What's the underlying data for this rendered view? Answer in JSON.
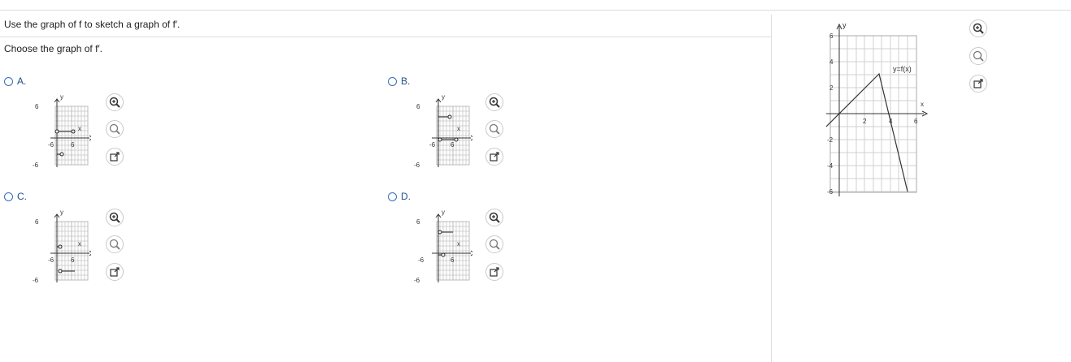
{
  "question": {
    "text": "Use the graph of f to sketch a graph of f′."
  },
  "prompt": {
    "text": "Choose the graph of f′."
  },
  "options": [
    {
      "letter": "A.",
      "y_top_label": "6",
      "y_bottom_label": "-6",
      "x_label": "x",
      "y_label": "y",
      "x_tick_left": "-6",
      "x_tick_right": "6"
    },
    {
      "letter": "B.",
      "y_top_label": "6",
      "y_bottom_label": "-6",
      "x_label": "x",
      "y_label": "y",
      "x_tick_left": "-6",
      "x_tick_right": "6"
    },
    {
      "letter": "C.",
      "y_top_label": "6",
      "y_bottom_label": "-6",
      "x_label": "x",
      "y_label": "y",
      "x_tick_left": "-6",
      "x_tick_right": "6"
    },
    {
      "letter": "D.",
      "y_top_label": "6",
      "y_bottom_label": "-6",
      "x_label": "x",
      "y_label": "y",
      "x_tick_left": "-6",
      "x_tick_right": "6"
    }
  ],
  "main_graph": {
    "y_label": "y",
    "x_label": "x",
    "curve_label": "y=f(x)",
    "y_ticks": [
      "6",
      "4",
      "2",
      "-2",
      "-4",
      "-6"
    ],
    "x_ticks": [
      "2",
      "4",
      "6"
    ]
  },
  "icons": {
    "zoom_in": "zoom-in-icon",
    "zoom_out": "zoom-out-icon",
    "popout": "popout-icon"
  }
}
